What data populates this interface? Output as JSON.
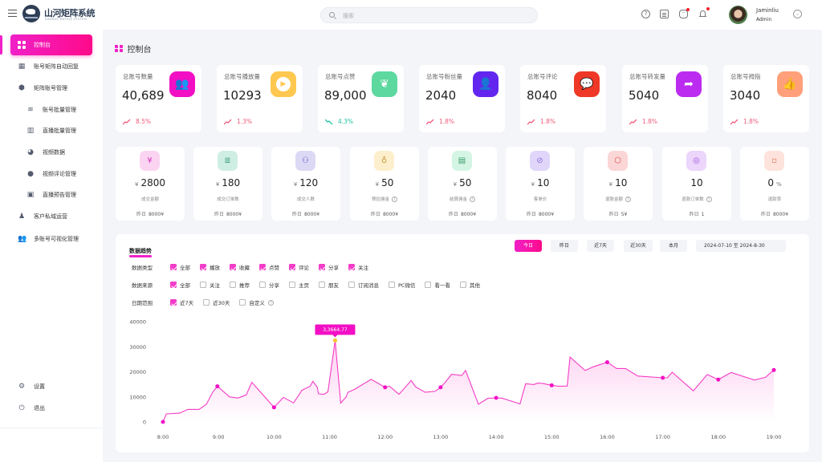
{
  "app": {
    "brand_title": "山河矩阵系统",
    "brand_subtitle": "SHANHE MATRIX SYSTEM"
  },
  "header": {
    "search_placeholder": "搜索",
    "icons": [
      "help-icon",
      "clipboard-icon",
      "message-icon",
      "bell-icon"
    ],
    "user": {
      "name": "Jaminliu",
      "role": "Admin"
    }
  },
  "sidebar": {
    "items": [
      {
        "label": "控制台",
        "icon": "dashboard-icon",
        "active": true,
        "level": 0
      },
      {
        "label": "账号矩阵自动回复",
        "icon": "grid-reply-icon",
        "level": 0
      },
      {
        "label": "矩阵账号管理",
        "icon": "cube-icon",
        "level": 0
      },
      {
        "label": "账号批量管理",
        "icon": "layers-icon",
        "level": 1
      },
      {
        "label": "直播批量管理",
        "icon": "live-batch-icon",
        "level": 1
      },
      {
        "label": "视频数据",
        "icon": "pie-chart-icon",
        "level": 1
      },
      {
        "label": "视频评论管理",
        "icon": "comment-icon",
        "level": 1
      },
      {
        "label": "直播预告管理",
        "icon": "calendar-icon",
        "level": 1
      },
      {
        "label": "客户私域运营",
        "icon": "user-icon",
        "level": 0
      },
      {
        "label": "多账号可视化管理",
        "icon": "users-icon",
        "level": 0
      }
    ],
    "bottom": [
      {
        "label": "设置",
        "icon": "gear-icon"
      },
      {
        "label": "退出",
        "icon": "power-icon"
      }
    ]
  },
  "page": {
    "title": "控制台"
  },
  "stats": [
    {
      "label": "总账号数量",
      "value": "40,689",
      "trend": "8.5%",
      "direction": "up",
      "icon": "users-icon",
      "color": "#f20fc4"
    },
    {
      "label": "总账号播放量",
      "value": "10293",
      "trend": "1.3%",
      "direction": "up",
      "icon": "play-icon",
      "color": "#fec74f"
    },
    {
      "label": "总账号点赞",
      "value": "89,000",
      "trend": "4.3%",
      "direction": "down",
      "icon": "tulip-icon",
      "color": "#5dd89f"
    },
    {
      "label": "总账号粉丝量",
      "value": "2040",
      "trend": "1.8%",
      "direction": "up",
      "icon": "fan-user-icon",
      "color": "#6226ef"
    },
    {
      "label": "总账号评论",
      "value": "8040",
      "trend": "1.8%",
      "direction": "up",
      "icon": "chat-bubble-icon",
      "color": "#ef3826"
    },
    {
      "label": "总账号转发量",
      "value": "5040",
      "trend": "1.8%",
      "direction": "up",
      "icon": "share-arrow-icon",
      "color": "#bb2cf0"
    },
    {
      "label": "总账号拇指",
      "value": "3040",
      "trend": "1.8%",
      "direction": "up",
      "icon": "thumbs-up-icon",
      "color": "#ffa07a"
    }
  ],
  "metrics": [
    {
      "currency": "¥",
      "value": "2800",
      "label": "成交金额",
      "help": false,
      "yesterday_label": "昨日",
      "yesterday": "8000¥",
      "icon": "yen-circle-icon",
      "bg": "#fbd4f2",
      "fg": "#d53cbf"
    },
    {
      "currency": "¥",
      "value": "180",
      "label": "成交订单数",
      "help": false,
      "yesterday_label": "昨日",
      "yesterday": "8000¥",
      "icon": "order-list-icon",
      "bg": "#cfeee3",
      "fg": "#3f9f7c"
    },
    {
      "currency": "¥",
      "value": "120",
      "label": "成交人数",
      "help": false,
      "yesterday_label": "昨日",
      "yesterday": "8000¥",
      "icon": "people-icon",
      "bg": "#dcd9f5",
      "fg": "#6a5bc3"
    },
    {
      "currency": "¥",
      "value": "50",
      "label": "预估佣金",
      "help": true,
      "yesterday_label": "昨日",
      "yesterday": "8000¥",
      "icon": "money-bag-icon",
      "bg": "#fdefcc",
      "fg": "#c9963a"
    },
    {
      "currency": "¥",
      "value": "50",
      "label": "结算佣金",
      "help": true,
      "yesterday_label": "昨日",
      "yesterday": "8000¥",
      "icon": "settlement-icon",
      "bg": "#d4f5e3",
      "fg": "#3a9a6a"
    },
    {
      "currency": "¥",
      "value": "10",
      "label": "客单价",
      "help": false,
      "yesterday_label": "昨日",
      "yesterday": "8000¥",
      "icon": "price-tag-icon",
      "bg": "#e0d6fa",
      "fg": "#8a6ee0"
    },
    {
      "currency": "¥",
      "value": "10",
      "label": "退款金额",
      "help": true,
      "yesterday_label": "昨日",
      "yesterday": "5¥",
      "icon": "refund-hex-icon",
      "bg": "#fbd6d6",
      "fg": "#d8504f"
    },
    {
      "currency": "",
      "value": "10",
      "label": "退款订单数",
      "help": true,
      "yesterday_label": "昨日",
      "yesterday": "1",
      "icon": "refund-circle-icon",
      "bg": "#ecd6fb",
      "fg": "#a251de"
    },
    {
      "currency": "",
      "value": "0",
      "suffix": "%",
      "label": "退款率",
      "help": false,
      "yesterday_label": "昨日",
      "yesterday": "8000¥",
      "icon": "refund-rate-icon",
      "bg": "#fde3dc",
      "fg": "#e07a5f"
    }
  ],
  "trend": {
    "title": "数据趋势",
    "range_buttons": [
      {
        "label": "今日",
        "active": true
      },
      {
        "label": "昨日",
        "active": false
      },
      {
        "label": "近7天",
        "active": false
      },
      {
        "label": "近30天",
        "active": false
      },
      {
        "label": "本月",
        "active": false
      }
    ],
    "date_range": "2024-07-10 至 2024-8-30",
    "filters": [
      {
        "label": "数据类型",
        "options": [
          {
            "label": "全部",
            "checked": true
          },
          {
            "label": "播放",
            "checked": true
          },
          {
            "label": "收藏",
            "checked": true
          },
          {
            "label": "点赞",
            "checked": true
          },
          {
            "label": "评论",
            "checked": true
          },
          {
            "label": "分享",
            "checked": true
          },
          {
            "label": "关注",
            "checked": true
          }
        ]
      },
      {
        "label": "数据来源",
        "options": [
          {
            "label": "全部",
            "checked": true
          },
          {
            "label": "关注",
            "checked": false
          },
          {
            "label": "推荐",
            "checked": false
          },
          {
            "label": "分享",
            "checked": false
          },
          {
            "label": "主页",
            "checked": false
          },
          {
            "label": "朋友",
            "checked": false
          },
          {
            "label": "订阅消息",
            "checked": false
          },
          {
            "label": "PC微信",
            "checked": false
          },
          {
            "label": "看一看",
            "checked": false
          },
          {
            "label": "其他",
            "checked": false
          }
        ]
      },
      {
        "label": "日期范围",
        "options": [
          {
            "label": "近7天",
            "checked": true
          },
          {
            "label": "近30天",
            "checked": false
          },
          {
            "label": "自定义",
            "checked": false,
            "help": true
          }
        ]
      }
    ]
  },
  "chart_data": {
    "type": "area",
    "title": "",
    "xlabel": "",
    "ylabel": "",
    "ylim": [
      0,
      40000
    ],
    "yticks": [
      0,
      10000,
      20000,
      30000,
      40000
    ],
    "xticks": [
      "8:00",
      "9:00",
      "10:00",
      "11:00",
      "12:00",
      "13:00",
      "14:00",
      "15:00",
      "16:00",
      "17:00",
      "18:00",
      "19:00"
    ],
    "xlim_hours": [
      8,
      19
    ],
    "grid": false,
    "legend": "none",
    "tooltip": {
      "label": "3,3664.77",
      "x": 11.1,
      "y": 32500
    },
    "series": [
      {
        "name": "数据趋势",
        "color": "#f53cc5",
        "x": [
          8.0,
          8.06,
          8.3,
          8.45,
          8.65,
          8.78,
          8.9,
          8.98,
          9.2,
          9.35,
          9.5,
          9.6,
          10.0,
          10.17,
          10.35,
          10.45,
          10.5,
          10.65,
          10.7,
          10.78,
          10.8,
          10.9,
          10.97,
          11.1,
          11.2,
          11.3,
          11.33,
          11.45,
          11.6,
          11.75,
          12.0,
          12.08,
          12.25,
          12.47,
          12.55,
          12.72,
          12.9,
          13.0,
          13.07,
          13.2,
          13.38,
          13.45,
          13.68,
          13.85,
          14.0,
          14.1,
          14.43,
          14.53,
          14.68,
          14.75,
          14.85,
          15.0,
          15.12,
          15.28,
          15.33,
          15.6,
          15.75,
          16.0,
          16.17,
          16.33,
          16.55,
          17.0,
          17.08,
          17.17,
          17.55,
          17.8,
          18.0,
          18.23,
          18.65,
          18.85,
          19.0
        ],
        "values": [
          0,
          3200,
          3500,
          5000,
          5000,
          7000,
          12000,
          14200,
          10000,
          9500,
          10800,
          15800,
          5800,
          9800,
          7600,
          10800,
          12600,
          14200,
          16200,
          13800,
          11200,
          11000,
          12000,
          32500,
          7500,
          10000,
          11800,
          13000,
          15000,
          17000,
          13800,
          14200,
          11000,
          16500,
          14000,
          11800,
          12200,
          13800,
          15500,
          19000,
          18500,
          20500,
          7000,
          9400,
          9600,
          9500,
          7200,
          15200,
          14900,
          15500,
          15300,
          14600,
          14200,
          14300,
          25900,
          20500,
          22000,
          23800,
          21300,
          21300,
          18300,
          17600,
          17600,
          19800,
          12400,
          18900,
          16900,
          19700,
          16700,
          17800,
          20700
        ]
      }
    ],
    "markers_x": [
      8.0,
      8.98,
      10.0,
      12.0,
      13.0,
      14.0,
      15.0,
      16.0,
      17.0,
      18.0,
      19.0
    ]
  }
}
